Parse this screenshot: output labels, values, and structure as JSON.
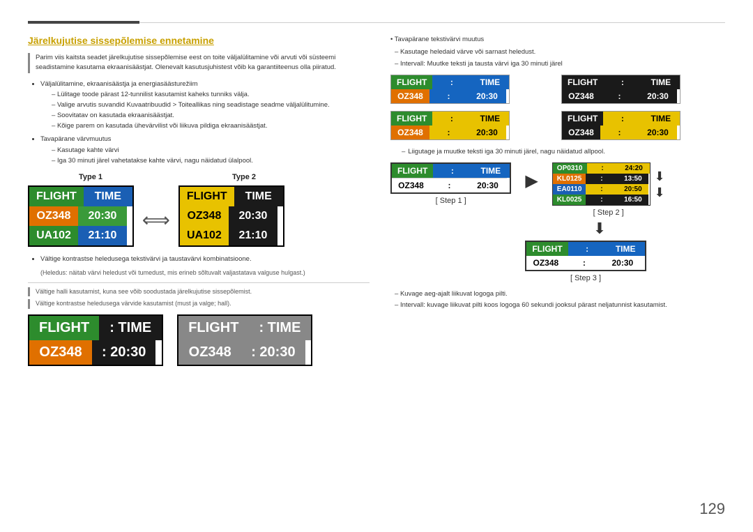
{
  "page": {
    "number": "129"
  },
  "header": {
    "section_title": "Järelkujutise sissepõlemise ennetamine"
  },
  "left": {
    "intro_text": "Parim viis kaitsta seadet järelkujutise sissepõlemise eest on toite väljalülitamine või arvuti või süsteemi seadistamine kasutama ekraanisäästjat. Olenevalt kasutusjuhistest võib ka garantiiteenus olla piiratud.",
    "bullets": [
      {
        "main": "Väljalülitamine, ekraanisäästja ja energiasäästurežiim",
        "dashes": [
          "Lülitage toode pärast 12-tunnilist kasutamist kaheks tunniks välja.",
          "Valige arvutis suvandid Kuvaatribuudid > Toiteallikas ning seadistage seadme väljalülitumine.",
          "Soovitatav on kasutada ekraanisäästjat.",
          "Kõige parem on kasutada ühevärvilist või liikuva pildiga ekraanisäästjat."
        ]
      },
      {
        "main": "Tavapärane värvmuutus",
        "dashes": [
          "Kasutage kahte värvi",
          "Iga 30 minuti järel vahetatakse kahte värvi, nagu näidatud ülalpool."
        ]
      }
    ],
    "type1_label": "Type 1",
    "type2_label": "Type 2",
    "board1": {
      "header": [
        "FLIGHT",
        "TIME"
      ],
      "rows": [
        [
          "OZ348",
          "20:30"
        ],
        [
          "UA102",
          "21:10"
        ]
      ]
    },
    "board2": {
      "header": [
        "FLIGHT",
        "TIME"
      ],
      "rows": [
        [
          "OZ348",
          "20:30"
        ],
        [
          "UA102",
          "21:10"
        ]
      ]
    },
    "bullets2": [
      "Vältige kontrastse heledusega tekstivärvi ja taustavärvi kombinatsioone.",
      "(Heledus: näitab värvi heledust või tumedust, mis erineb sõltuvalt valjastatava valguse hulgast.)"
    ],
    "dash_rules": [
      "Vältige halli kasutamist, kuna see võib soodustada järelkujutise sissepõlemist.",
      "Vältige kontrastse heledusega värvide kasutamist (must ja valge; hall)."
    ],
    "bottom_boards": [
      {
        "type": "dark",
        "header": [
          "FLIGHT",
          "TIME"
        ],
        "row": [
          "OZ348",
          "20:30"
        ]
      },
      {
        "type": "gray",
        "header": [
          "FLIGHT",
          "TIME"
        ],
        "row": [
          "OZ348",
          "20:30"
        ]
      }
    ]
  },
  "right": {
    "bullet1": "Tavapärane tekstivärvi muutus",
    "dashes": [
      "Kasutage heledaid värve või sarnast heledust.",
      "Intervall: Muutke teksti ja tausta värvi iga 30 minuti järel"
    ],
    "grid_boards": [
      {
        "header_colors": [
          "green",
          "blue"
        ],
        "row_colors": [
          "orange",
          "blue"
        ],
        "header": [
          "FLIGHT",
          "TIME"
        ],
        "row": [
          "OZ348",
          "20:30"
        ]
      },
      {
        "header_colors": [
          "dark",
          "dark"
        ],
        "row_colors": [
          "dark",
          "dark"
        ],
        "header": [
          "FLIGHT",
          "TIME"
        ],
        "row": [
          "OZ348",
          "20:30"
        ]
      },
      {
        "header_colors": [
          "green",
          "yellow"
        ],
        "row_colors": [
          "orange",
          "yellow"
        ],
        "header": [
          "FLIGHT",
          "TIME"
        ],
        "row": [
          "OZ348",
          "20:30"
        ]
      },
      {
        "header_colors": [
          "dark",
          "yellow"
        ],
        "row_colors": [
          "dark",
          "yellow"
        ],
        "header": [
          "FLIGHT",
          "TIME"
        ],
        "row": [
          "OZ348",
          "20:30"
        ]
      }
    ],
    "dash2": "Liigutage ja muutke teksti iga 30 minuti järel, nagu näidatud allpool.",
    "step1_label": "[ Step 1 ]",
    "step2_label": "[ Step 2 ]",
    "step3_label": "[ Step 3 ]",
    "step1_board": {
      "header": [
        "FLIGHT",
        "TIME"
      ],
      "row": [
        "OZ348",
        "20:30"
      ]
    },
    "step2_boards": [
      {
        "text": "OP0310 : 24:20"
      },
      {
        "text": "KL0125 : 13:50"
      },
      {
        "text": "EA0110 : 20:50"
      },
      {
        "text": "KL0025 : 16:50"
      }
    ],
    "step3_board": {
      "header": [
        "FLIGHT",
        "TIME"
      ],
      "row": [
        "OZ348",
        "20:30"
      ]
    },
    "dash3": "Kuvage aeg-ajalt liikuvat logoga pilti.",
    "dash4": "Intervall: kuvage liikuvat pilti koos logoga 60 sekundi jooksul pärast neljatunnist kasutamist."
  }
}
